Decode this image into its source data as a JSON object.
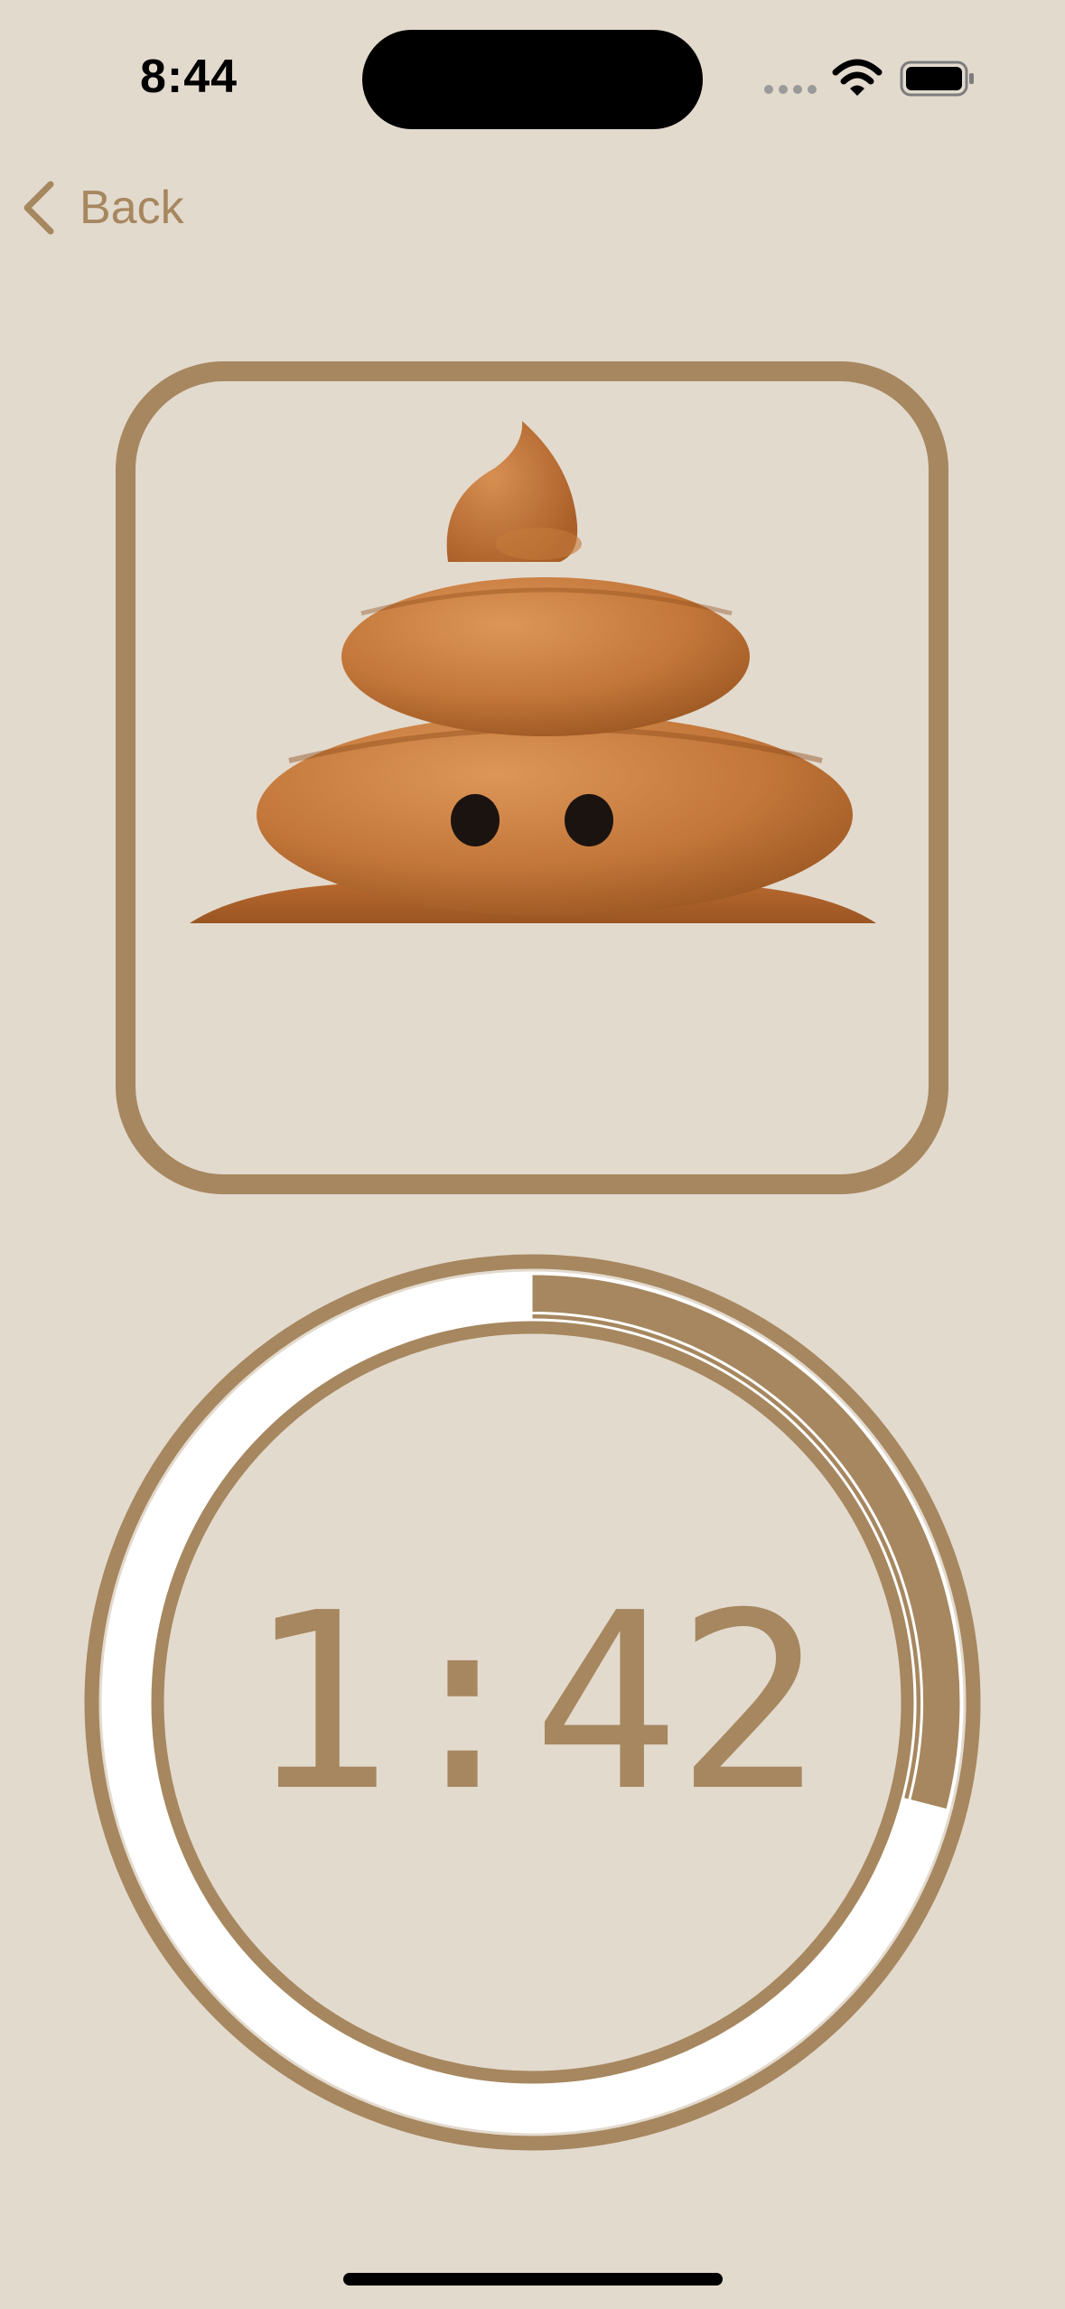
{
  "status_bar": {
    "time": "8:44"
  },
  "navigation": {
    "back_label": "Back"
  },
  "illustration": {
    "icon": "poop-emoji-3d"
  },
  "timer": {
    "display": "1:42",
    "progress": 0.29
  },
  "colors": {
    "background": "#e3dace",
    "accent": "#a6875f",
    "track": "#ffffff",
    "poop": "#c7783a"
  }
}
